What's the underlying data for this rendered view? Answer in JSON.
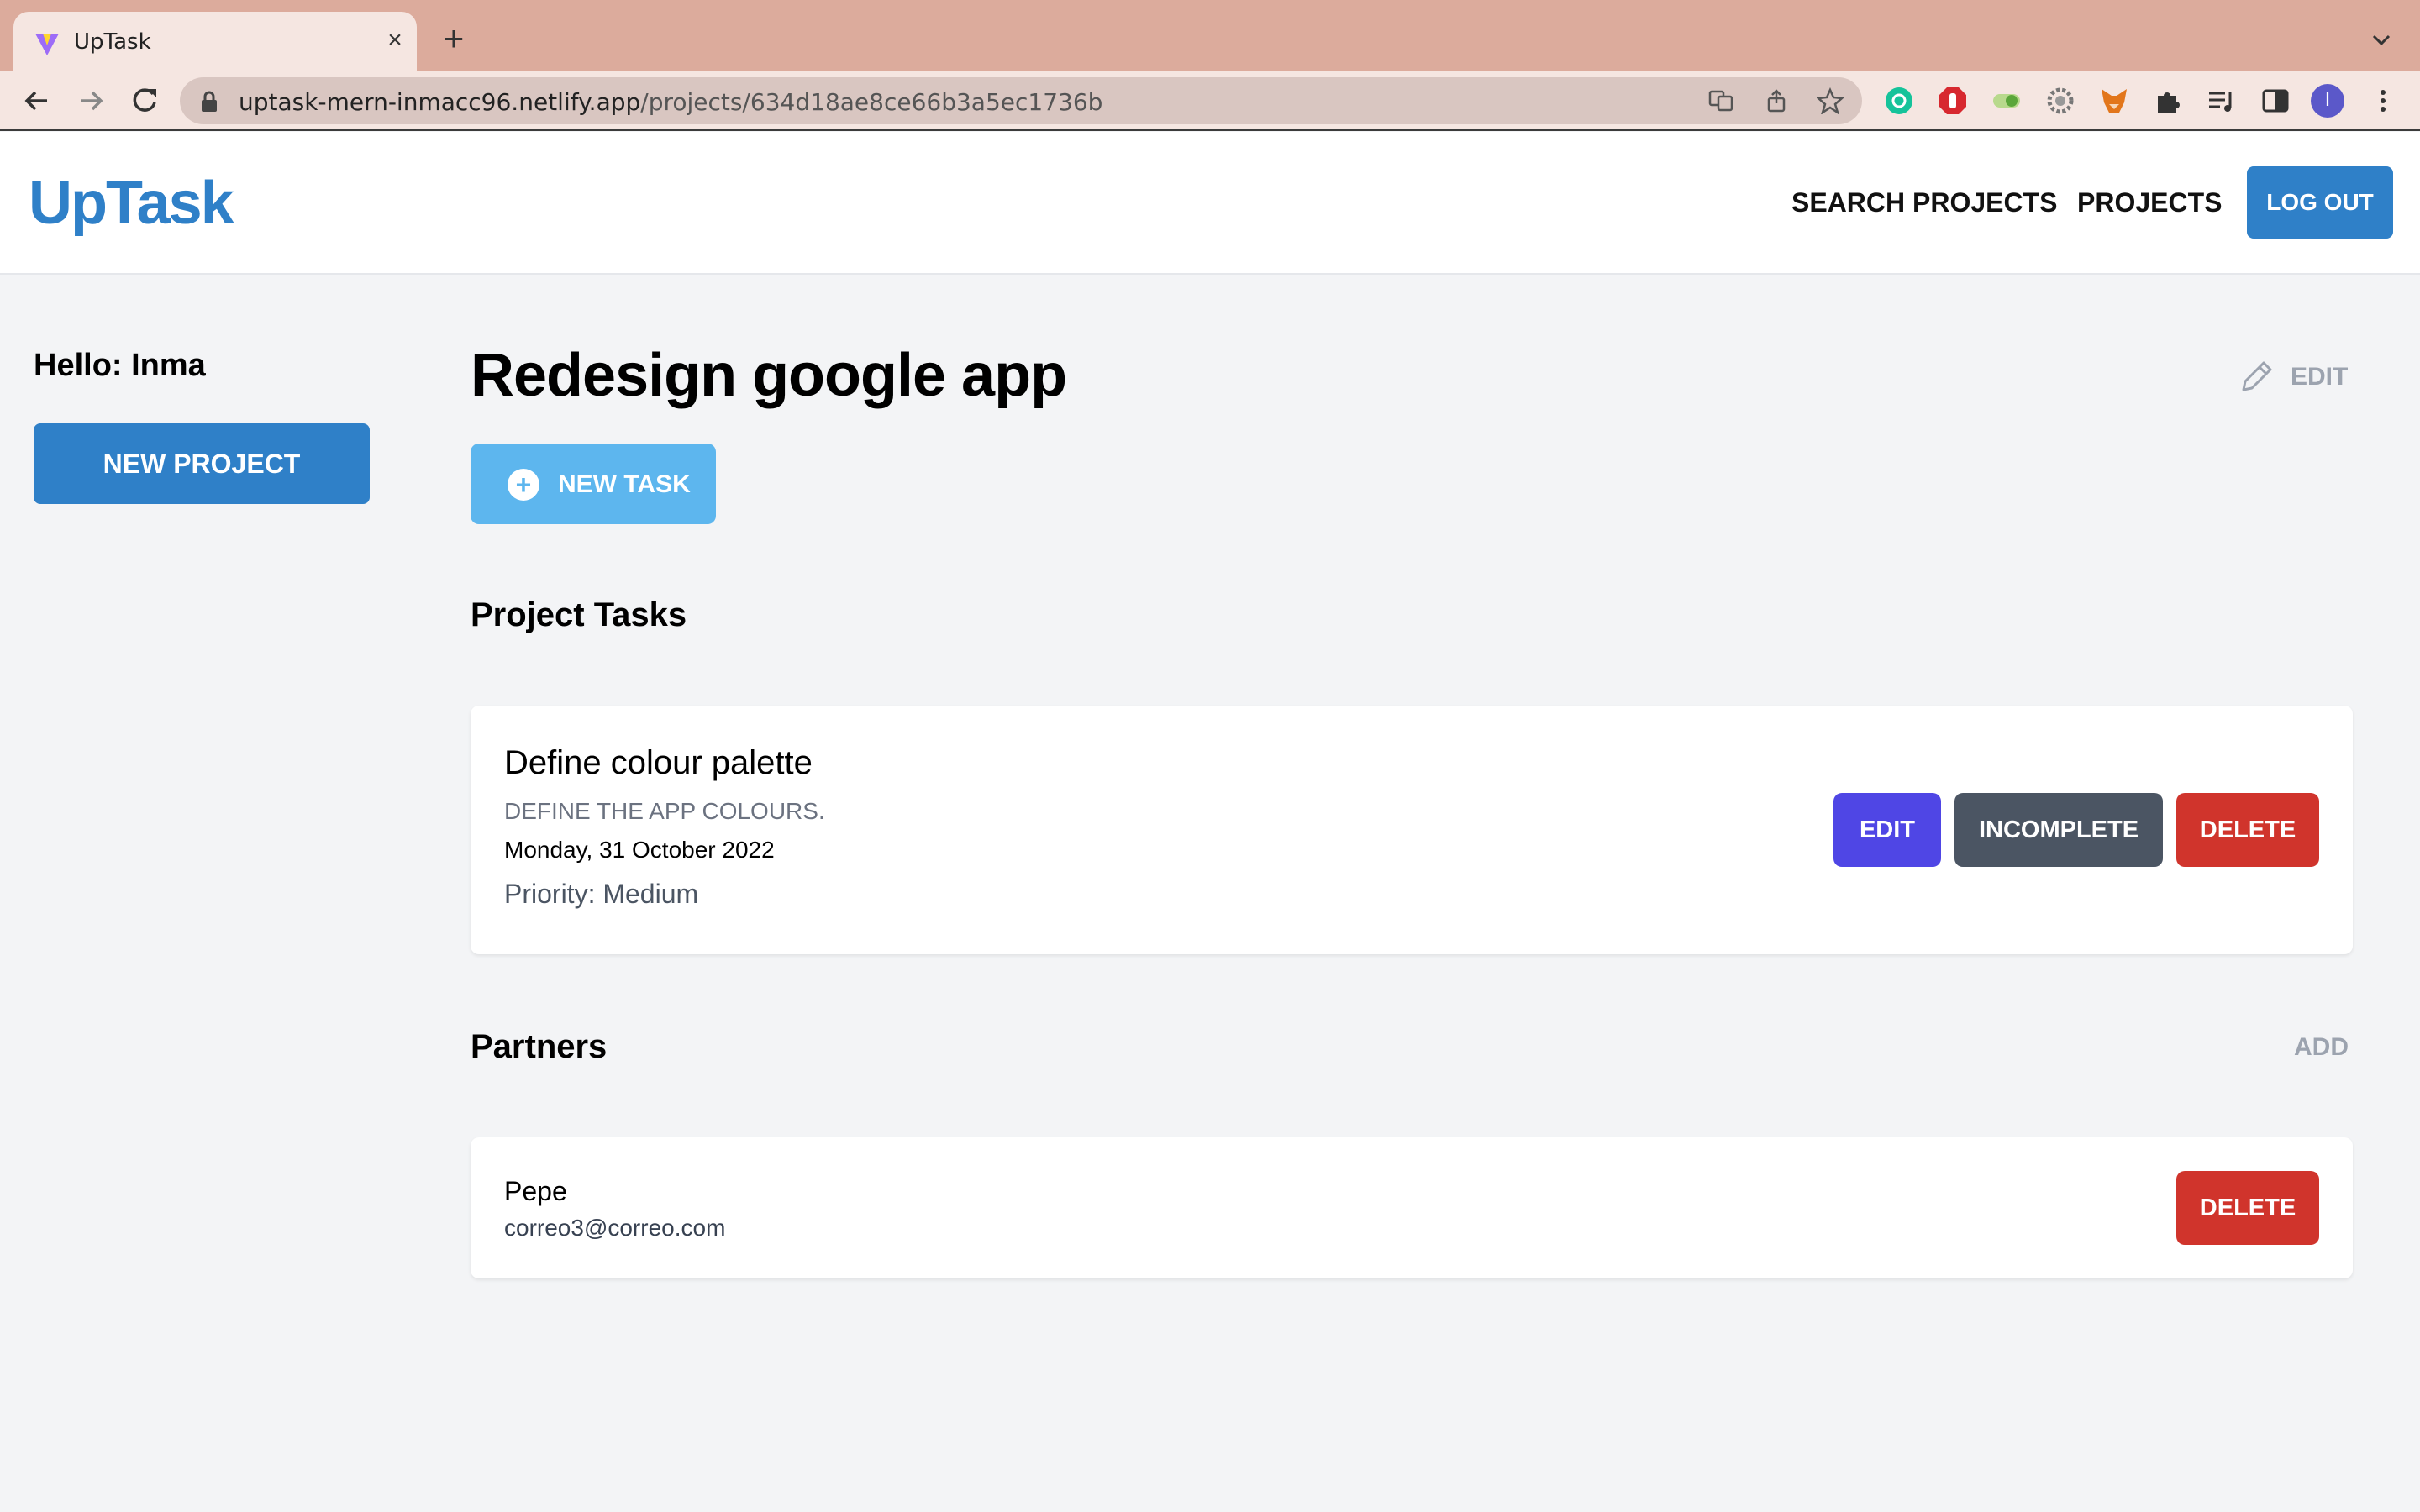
{
  "browser": {
    "tab_title": "UpTask",
    "tab_close": "×",
    "new_tab": "+",
    "url_host": "uptask-mern-inmacc96.netlify.app",
    "url_path": "/projects/634d18ae8ce66b3a5ec1736b",
    "profile_initial": "I"
  },
  "header": {
    "logo": "UpTask",
    "search_projects": "SEARCH PROJECTS",
    "projects": "PROJECTS",
    "logout": "LOG OUT"
  },
  "sidebar": {
    "greeting": "Hello: Inma",
    "new_project": "NEW PROJECT"
  },
  "project": {
    "title": "Redesign google app",
    "edit_label": "EDIT",
    "new_task_label": "NEW TASK",
    "new_task_icon": "+",
    "tasks_heading": "Project Tasks",
    "tasks": [
      {
        "name": "Define colour palette",
        "description": "DEFINE THE APP COLOURS.",
        "date": "Monday, 31 October 2022",
        "priority": "Priority: Medium",
        "edit": "EDIT",
        "status": "INCOMPLETE",
        "delete": "DELETE"
      }
    ],
    "partners_heading": "Partners",
    "add_partner": "ADD",
    "partners": [
      {
        "name": "Pepe",
        "email": "correo3@correo.com",
        "delete": "DELETE"
      }
    ]
  },
  "colors": {
    "brand": "#2f80c8",
    "new_task": "#5db6ee",
    "edit": "#4f46e5",
    "incomplete": "#4b5563",
    "delete": "#d0342c"
  },
  "icons": {
    "tab_favicon": "vite-logo-icon",
    "back": "arrow-left-icon",
    "forward": "arrow-right-icon",
    "reload": "reload-icon",
    "lock": "lock-icon",
    "translate": "translate-icon",
    "share": "share-icon",
    "bookmark": "star-icon",
    "edit_project": "pencil-icon"
  }
}
